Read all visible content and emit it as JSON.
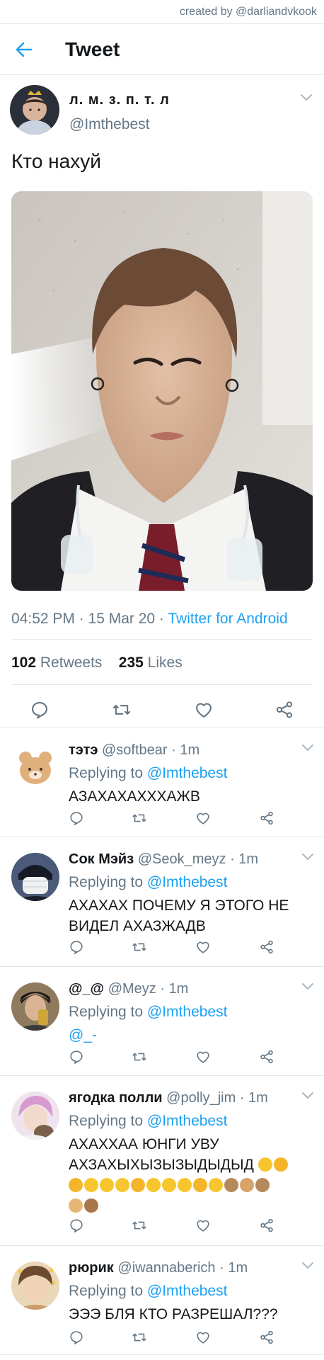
{
  "credit": "created by @darliandvkook",
  "header": {
    "title": "Tweet"
  },
  "tweet": {
    "name": "л. м. з. п. т. л",
    "handle": "@Imthebest",
    "text": "Кто нахуй",
    "time": "04:52 PM · 15 Mar 20 · ",
    "source": "Twitter for Android",
    "retweets_count": "102",
    "retweets_label": "Retweets",
    "likes_count": "235",
    "likes_label": "Likes"
  },
  "replies": [
    {
      "name": "тэтэ",
      "meta": "@softbear · 1m",
      "replying": "Replying to ",
      "mention": "@Imthebest",
      "text": "АЗАХАХАХХХАЖВ"
    },
    {
      "name": "Сок Мэйз",
      "meta": "@Seok_meyz · 1m",
      "replying": "Replying to ",
      "mention": "@Imthebest",
      "text": "АХАХАХ ПОЧЕМУ Я ЭТОГО НЕ ВИДЕЛ АХАЗЖАДВ"
    },
    {
      "name": "@_@",
      "meta": "@Meyz · 1m",
      "replying": "Replying to ",
      "mention": "@Imthebest",
      "text": "@_-"
    },
    {
      "name": "ягодка полли",
      "meta": "@polly_jim · 1m",
      "replying": "Replying to ",
      "mention": "@Imthebest",
      "text": "АХАХХАА ЮНГИ УВУ АХЗАХЫХЫЗЫЗЫДЫДЫД"
    },
    {
      "name": "рюрик",
      "meta": "@iwannaberich · 1m",
      "replying": "Replying to ",
      "mention": "@Imthebest",
      "text": "ЭЭЭ БЛЯ КТО РАЗРЕШАЛ???"
    }
  ],
  "icons": {
    "back": "arrow-left-icon",
    "reply": "comment-icon",
    "retweet": "retweet-icon",
    "like": "heart-icon",
    "share": "share-icon",
    "more": "chevron-down-icon"
  },
  "colors": {
    "accent": "#1da1f2",
    "muted": "#657786",
    "text": "#14171a",
    "border": "#e1e8ed"
  }
}
